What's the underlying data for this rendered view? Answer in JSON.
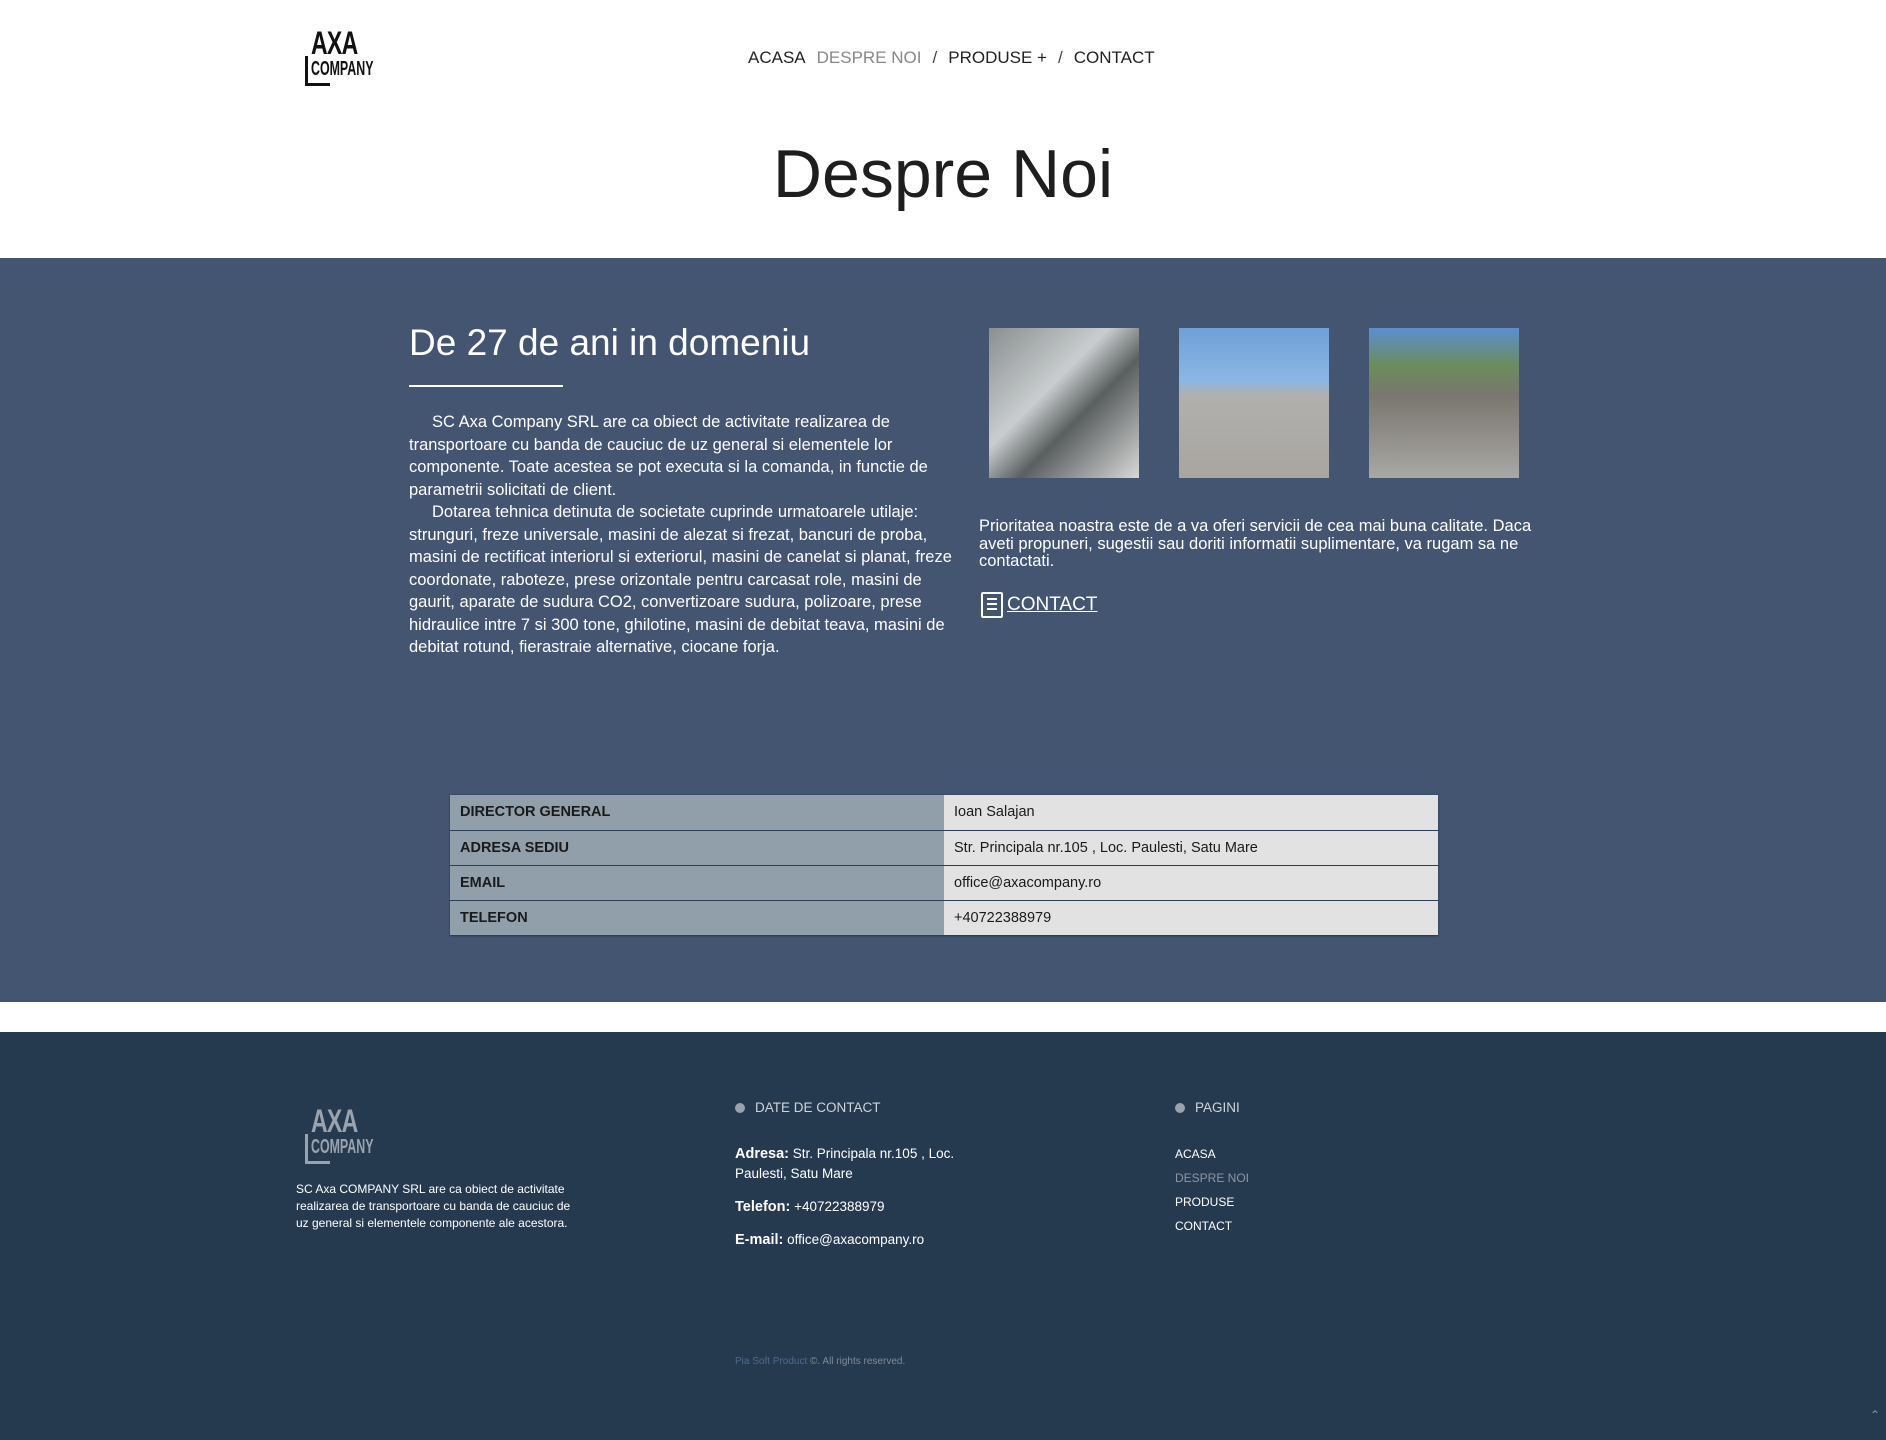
{
  "logo": {
    "line1": "AXA",
    "line2": "COMPANY"
  },
  "nav": {
    "items": [
      "ACASA",
      "DESPRE NOI",
      "PRODUSE +",
      "CONTACT"
    ],
    "separator": "/"
  },
  "page_title": "Despre Noi",
  "about": {
    "heading": "De 27 de ani in domeniu",
    "paragraphs": [
      "SC Axa Company SRL are ca obiect de activitate realizarea de transportoare  cu banda de cauciuc de uz general si elementele lor componente. Toate acestea se pot  executa si la comanda,  in functie de parametrii solicitati de client.",
      "Dotarea tehnica detinuta de societate cuprinde urmatoarele utilaje: strunguri, freze universale, masini de alezat si frezat, bancuri de proba, masini de rectificat interiorul si exteriorul, masini de canelat si planat, freze coordonate, raboteze, prese orizontale pentru carcasat role, masini de gaurit, aparate de sudura CO2, convertizoare sudura, polizoare, prese hidraulice intre 7 si 300 tone, ghilotine, masini de debitat teava, masini de debitat rotund, fierastraie alternative, ciocane forja."
    ],
    "priority_text": "Prioritatea noastra este de a va oferi servicii de cea mai buna calitate. Daca aveti propuneri, sugestii sau doriti informatii suplimentare, va rugam sa ne contactati.",
    "contact_link": "CONTACT"
  },
  "info_table": [
    {
      "key": "DIRECTOR GENERAL",
      "value": "Ioan Salajan"
    },
    {
      "key": "ADRESA SEDIU",
      "value": "Str. Principala nr.105 , Loc. Paulesti, Satu Mare"
    },
    {
      "key": "EMAIL",
      "value": "office@axacompany.ro"
    },
    {
      "key": "TELEFON",
      "value": "+40722388979"
    }
  ],
  "footer": {
    "description": "SC Axa COMPANY SRL are ca obiect de activitate realizarea de transportoare cu banda de cauciuc de uz general si elementele componente ale acestora.",
    "contact_heading": "DATE DE CONTACT",
    "address_label": "Adresa:",
    "address": " Str. Principala nr.105 , Loc. Paulesti, Satu Mare",
    "phone_label": "Telefon:",
    "phone": " +40722388979",
    "email_label": "E-mail:",
    "email": " office@axacompany.ro",
    "pages_heading": "PAGINI",
    "pages": [
      "ACASA",
      "DESPRE NOI",
      "PRODUSE",
      "CONTACT"
    ],
    "copyright_link": "Pia Soft Product",
    "copyright_text": " ©. All rights reserved."
  },
  "colors": {
    "band": "#435570",
    "footer": "#263a4f",
    "table_key": "#919fab",
    "table_value": "#e2e2e2"
  }
}
